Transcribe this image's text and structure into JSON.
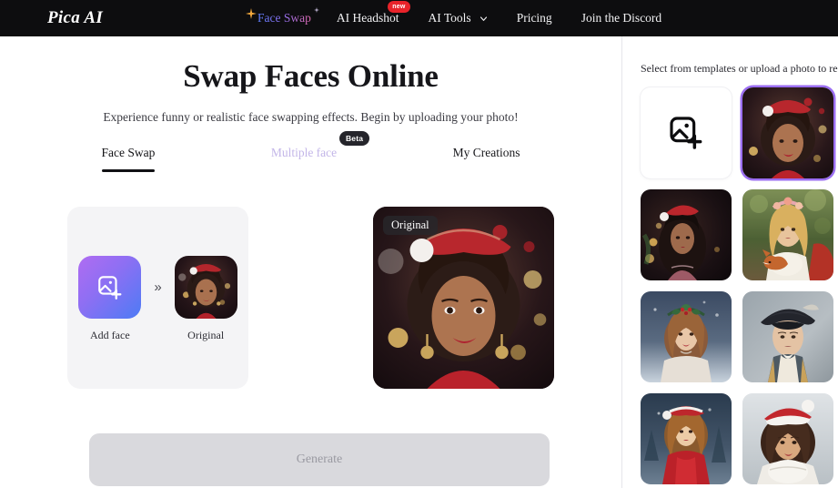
{
  "header": {
    "logo": "Pica AI",
    "nav": [
      {
        "label": "Face Swap",
        "icon": "sparkle-icon",
        "style": "gradient",
        "badge": null
      },
      {
        "label": "AI Headshot",
        "icon": null,
        "style": "plain",
        "badge": "new"
      },
      {
        "label": "AI Tools",
        "icon": "chevron-down-icon",
        "style": "plain",
        "badge": null
      },
      {
        "label": "Pricing",
        "icon": null,
        "style": "plain",
        "badge": null
      },
      {
        "label": "Join the Discord",
        "icon": null,
        "style": "plain",
        "badge": null
      }
    ]
  },
  "main": {
    "title": "Swap Faces Online",
    "subtitle": "Experience funny or realistic face swapping effects. Begin by uploading your photo!",
    "tabs": [
      {
        "label": "Face Swap",
        "active": true,
        "badge": null
      },
      {
        "label": "Multiple face",
        "active": false,
        "badge": "Beta"
      },
      {
        "label": "My Creations",
        "active": false,
        "badge": null
      }
    ],
    "faces": {
      "add_face_label": "Add face",
      "add_face_icon": "image-plus-icon",
      "separator": "»",
      "original_label": "Original"
    },
    "preview": {
      "badge": "Original"
    },
    "generate_label": "Generate",
    "generate_disabled": true
  },
  "sidebar": {
    "title": "Select from templates or upload a photo to reface",
    "upload_tile": {
      "icon": "image-plus-icon",
      "label": ""
    },
    "templates": [
      {
        "name": "santa-hat-curly-portrait",
        "selected": true
      },
      {
        "name": "santa-hat-dark-hair-lights",
        "selected": false
      },
      {
        "name": "floral-crown-with-fox",
        "selected": false
      },
      {
        "name": "holly-crown-winter-portrait",
        "selected": false
      },
      {
        "name": "tricorn-hat-officer-portrait",
        "selected": false
      },
      {
        "name": "red-dress-snowy-forest",
        "selected": false
      },
      {
        "name": "santa-hat-white-scarf",
        "selected": false
      }
    ]
  },
  "colors": {
    "header_bg": "#0d0d0f",
    "accent_purple": "#9b6ef2",
    "accent_blue": "#4d7bf5",
    "badge_red": "#e8232a",
    "badge_dark": "#25252b",
    "panel_grey": "#f4f4f6",
    "generate_grey": "#d9d9dd"
  }
}
